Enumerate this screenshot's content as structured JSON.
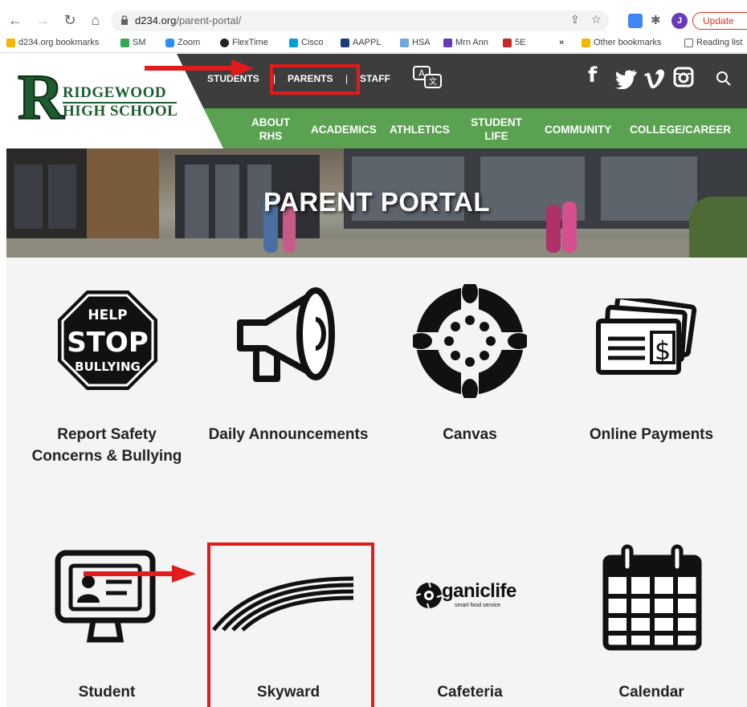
{
  "browser": {
    "url_host": "d234.org",
    "url_path": "/parent-portal/",
    "profile_initial": "J",
    "update_label": "Update",
    "bookmarks": [
      {
        "label": "d234.org bookmarks",
        "color": "#f4b400"
      },
      {
        "label": "SM",
        "color": "#34a853"
      },
      {
        "label": "Zoom",
        "color": "#2d8cff"
      },
      {
        "label": "FlexTime",
        "color": "#222222"
      },
      {
        "label": "Cisco",
        "color": "#049fd9"
      },
      {
        "label": "AAPPL",
        "color": "#1a3e72"
      },
      {
        "label": "HSA",
        "color": "#6fa8dc"
      },
      {
        "label": "Mrn Ann",
        "color": "#673ab7"
      },
      {
        "label": "5E",
        "color": "#c62828"
      },
      {
        "label": "Other bookmarks",
        "color": "#f4b400"
      },
      {
        "label": "Reading list",
        "color": "#5f6368"
      }
    ],
    "overflow_label": "»"
  },
  "site": {
    "logo_line1": "RIDGEWOOD",
    "logo_line2": "HIGH SCHOOL",
    "logo_letter": "R",
    "top_nav": {
      "students": "STUDENTS",
      "parents": "PARENTS",
      "staff": "STAFF",
      "separator": "|"
    },
    "main_nav": [
      "ABOUT RHS",
      "ACADEMICS",
      "ATHLETICS",
      "STUDENT LIFE",
      "COMMUNITY",
      "COLLEGE/CAREER"
    ],
    "hero_title": "PARENT PORTAL",
    "stop_sign": {
      "top": "HELP",
      "middle": "STOP",
      "bottom": "BULLYING"
    },
    "tiles": [
      {
        "label": "Report Safety Concerns & Bullying",
        "icon": "stop-sign-icon"
      },
      {
        "label": "Daily Announcements",
        "icon": "megaphone-icon"
      },
      {
        "label": "Canvas",
        "icon": "canvas-logo-icon"
      },
      {
        "label": "Online Payments",
        "icon": "payment-cards-icon"
      },
      {
        "label": "Student",
        "icon": "student-monitor-icon"
      },
      {
        "label": "Skyward",
        "icon": "skyward-logo-icon"
      },
      {
        "label": "Cafeteria",
        "icon": "organiclife-logo-icon"
      },
      {
        "label": "Calendar",
        "icon": "calendar-icon"
      }
    ],
    "organiclife": {
      "name": "ganiclife",
      "tagline": "smart food service"
    }
  },
  "annotations": {
    "color": "#e01b1b"
  }
}
